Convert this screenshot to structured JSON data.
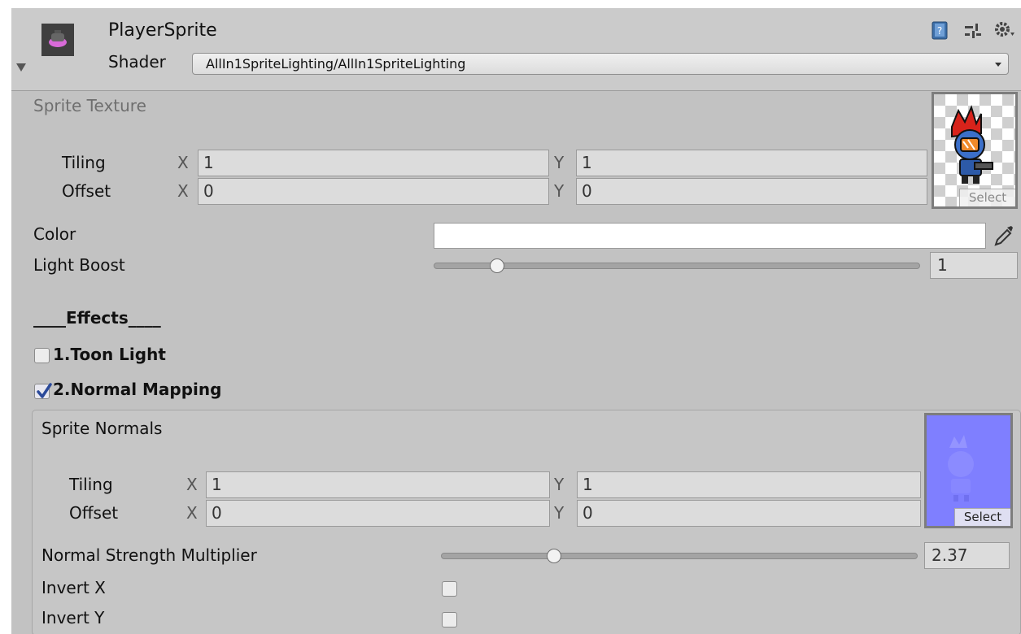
{
  "header": {
    "material_name": "PlayerSprite",
    "shader_label": "Shader",
    "shader_value": "AllIn1SpriteLighting/AllIn1SpriteLighting"
  },
  "sprite_texture": {
    "label": "Sprite Texture",
    "tiling_label": "Tiling",
    "offset_label": "Offset",
    "x_axis": "X",
    "y_axis": "Y",
    "tiling_x": "1",
    "tiling_y": "1",
    "offset_x": "0",
    "offset_y": "0",
    "select_label": "Select"
  },
  "color": {
    "label": "Color",
    "value": "#ffffff"
  },
  "light_boost": {
    "label": "Light Boost",
    "value": "1",
    "slider_fraction": 0.13
  },
  "effects": {
    "heading": "____Effects____",
    "toon_light": {
      "label": "1.Toon Light",
      "checked": false
    },
    "normal_mapping": {
      "label": "2.Normal Mapping",
      "checked": true
    }
  },
  "sprite_normals": {
    "label": "Sprite Normals",
    "tiling_label": "Tiling",
    "offset_label": "Offset",
    "x_axis": "X",
    "y_axis": "Y",
    "tiling_x": "1",
    "tiling_y": "1",
    "offset_x": "0",
    "offset_y": "0",
    "select_label": "Select"
  },
  "normal_strength": {
    "label": "Normal Strength Multiplier",
    "value": "2.37",
    "slider_fraction": 0.237
  },
  "invert_x": {
    "label": "Invert X",
    "checked": false
  },
  "invert_y": {
    "label": "Invert Y",
    "checked": false
  },
  "colors": {
    "panel_bg": "#c2c2c2",
    "header_bg": "#cbcbcb",
    "normal_map": "#7f7fff",
    "checkbox_check": "#2b4a9a"
  }
}
